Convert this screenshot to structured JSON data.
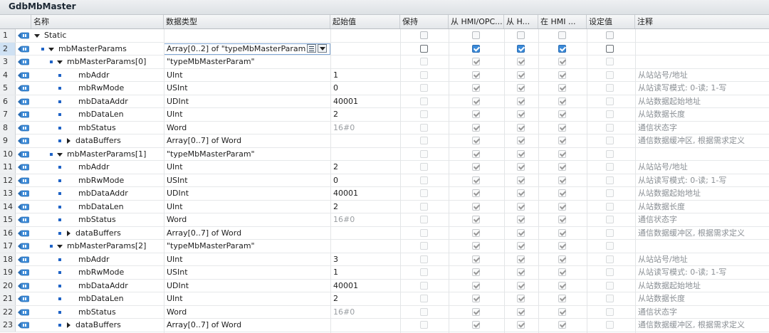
{
  "window": {
    "title": "GdbMbMaster"
  },
  "columns": {
    "name": "名称",
    "datatype": "数据类型",
    "start": "起始值",
    "retain": "保持",
    "hmi_opc": "从 HMI/OPC...",
    "hmi_h": "从 H...",
    "in_hmi": "在 HMI ...",
    "setpoint": "设定值",
    "comment": "注释"
  },
  "rows": [
    {
      "num": "1",
      "indent": 0,
      "bullet": false,
      "exp": "down",
      "name": "Static",
      "type": "",
      "start": "",
      "retain": false,
      "hmi": false,
      "hmih": false,
      "inhmi": false,
      "set": false,
      "comment": "",
      "dim": false
    },
    {
      "num": "2",
      "indent": 1,
      "bullet": true,
      "exp": "down",
      "name": "mbMasterParams",
      "type": "Array[0..2] of \"typeMbMasterParam\"",
      "start": "",
      "retain": false,
      "hmi": true,
      "hmih": true,
      "inhmi": true,
      "set": false,
      "comment": "",
      "dim": false,
      "sel": true
    },
    {
      "num": "3",
      "indent": 2,
      "bullet": true,
      "exp": "down",
      "name": "mbMasterParams[0]",
      "type": "\"typeMbMasterParam\"",
      "start": "",
      "retain": false,
      "hmi": true,
      "hmih": true,
      "inhmi": true,
      "set": false,
      "comment": "",
      "dim": true
    },
    {
      "num": "4",
      "indent": 3,
      "bullet": true,
      "exp": "",
      "name": "mbAddr",
      "type": "UInt",
      "start": "1",
      "retain": false,
      "hmi": true,
      "hmih": true,
      "inhmi": true,
      "set": false,
      "comment": "从站站号/地址",
      "dim": true
    },
    {
      "num": "5",
      "indent": 3,
      "bullet": true,
      "exp": "",
      "name": "mbRwMode",
      "type": "USInt",
      "start": "0",
      "retain": false,
      "hmi": true,
      "hmih": true,
      "inhmi": true,
      "set": false,
      "comment": "从站读写模式: 0-读; 1-写",
      "dim": true
    },
    {
      "num": "6",
      "indent": 3,
      "bullet": true,
      "exp": "",
      "name": "mbDataAddr",
      "type": "UDInt",
      "start": "40001",
      "retain": false,
      "hmi": true,
      "hmih": true,
      "inhmi": true,
      "set": false,
      "comment": "从站数据起始地址",
      "dim": true
    },
    {
      "num": "7",
      "indent": 3,
      "bullet": true,
      "exp": "",
      "name": "mbDataLen",
      "type": "UInt",
      "start": "2",
      "retain": false,
      "hmi": true,
      "hmih": true,
      "inhmi": true,
      "set": false,
      "comment": "从站数据长度",
      "dim": true
    },
    {
      "num": "8",
      "indent": 3,
      "bullet": true,
      "exp": "",
      "name": "mbStatus",
      "type": "Word",
      "start": "16#0",
      "startdim": true,
      "retain": false,
      "hmi": true,
      "hmih": true,
      "inhmi": true,
      "set": false,
      "comment": "通信状态字",
      "dim": true
    },
    {
      "num": "9",
      "indent": 3,
      "bullet": true,
      "exp": "right",
      "name": "dataBuffers",
      "type": "Array[0..7] of Word",
      "start": "",
      "retain": false,
      "hmi": true,
      "hmih": true,
      "inhmi": true,
      "set": false,
      "comment": "通信数据缓冲区, 根据需求定义",
      "dim": true
    },
    {
      "num": "10",
      "indent": 2,
      "bullet": true,
      "exp": "down",
      "name": "mbMasterParams[1]",
      "type": "\"typeMbMasterParam\"",
      "start": "",
      "retain": false,
      "hmi": true,
      "hmih": true,
      "inhmi": true,
      "set": false,
      "comment": "",
      "dim": true
    },
    {
      "num": "11",
      "indent": 3,
      "bullet": true,
      "exp": "",
      "name": "mbAddr",
      "type": "UInt",
      "start": "2",
      "retain": false,
      "hmi": true,
      "hmih": true,
      "inhmi": true,
      "set": false,
      "comment": "从站站号/地址",
      "dim": true
    },
    {
      "num": "12",
      "indent": 3,
      "bullet": true,
      "exp": "",
      "name": "mbRwMode",
      "type": "USInt",
      "start": "0",
      "retain": false,
      "hmi": true,
      "hmih": true,
      "inhmi": true,
      "set": false,
      "comment": "从站读写模式: 0-读; 1-写",
      "dim": true
    },
    {
      "num": "13",
      "indent": 3,
      "bullet": true,
      "exp": "",
      "name": "mbDataAddr",
      "type": "UDInt",
      "start": "40001",
      "retain": false,
      "hmi": true,
      "hmih": true,
      "inhmi": true,
      "set": false,
      "comment": "从站数据起始地址",
      "dim": true
    },
    {
      "num": "14",
      "indent": 3,
      "bullet": true,
      "exp": "",
      "name": "mbDataLen",
      "type": "UInt",
      "start": "2",
      "retain": false,
      "hmi": true,
      "hmih": true,
      "inhmi": true,
      "set": false,
      "comment": "从站数据长度",
      "dim": true
    },
    {
      "num": "15",
      "indent": 3,
      "bullet": true,
      "exp": "",
      "name": "mbStatus",
      "type": "Word",
      "start": "16#0",
      "startdim": true,
      "retain": false,
      "hmi": true,
      "hmih": true,
      "inhmi": true,
      "set": false,
      "comment": "通信状态字",
      "dim": true
    },
    {
      "num": "16",
      "indent": 3,
      "bullet": true,
      "exp": "right",
      "name": "dataBuffers",
      "type": "Array[0..7] of Word",
      "start": "",
      "retain": false,
      "hmi": true,
      "hmih": true,
      "inhmi": true,
      "set": false,
      "comment": "通信数据缓冲区, 根据需求定义",
      "dim": true
    },
    {
      "num": "17",
      "indent": 2,
      "bullet": true,
      "exp": "down",
      "name": "mbMasterParams[2]",
      "type": "\"typeMbMasterParam\"",
      "start": "",
      "retain": false,
      "hmi": true,
      "hmih": true,
      "inhmi": true,
      "set": false,
      "comment": "",
      "dim": true
    },
    {
      "num": "18",
      "indent": 3,
      "bullet": true,
      "exp": "",
      "name": "mbAddr",
      "type": "UInt",
      "start": "3",
      "retain": false,
      "hmi": true,
      "hmih": true,
      "inhmi": true,
      "set": false,
      "comment": "从站站号/地址",
      "dim": true
    },
    {
      "num": "19",
      "indent": 3,
      "bullet": true,
      "exp": "",
      "name": "mbRwMode",
      "type": "USInt",
      "start": "1",
      "retain": false,
      "hmi": true,
      "hmih": true,
      "inhmi": true,
      "set": false,
      "comment": "从站读写模式: 0-读; 1-写",
      "dim": true
    },
    {
      "num": "20",
      "indent": 3,
      "bullet": true,
      "exp": "",
      "name": "mbDataAddr",
      "type": "UDInt",
      "start": "40001",
      "retain": false,
      "hmi": true,
      "hmih": true,
      "inhmi": true,
      "set": false,
      "comment": "从站数据起始地址",
      "dim": true
    },
    {
      "num": "21",
      "indent": 3,
      "bullet": true,
      "exp": "",
      "name": "mbDataLen",
      "type": "UInt",
      "start": "2",
      "retain": false,
      "hmi": true,
      "hmih": true,
      "inhmi": true,
      "set": false,
      "comment": "从站数据长度",
      "dim": true
    },
    {
      "num": "22",
      "indent": 3,
      "bullet": true,
      "exp": "",
      "name": "mbStatus",
      "type": "Word",
      "start": "16#0",
      "startdim": true,
      "retain": false,
      "hmi": true,
      "hmih": true,
      "inhmi": true,
      "set": false,
      "comment": "通信状态字",
      "dim": true
    },
    {
      "num": "23",
      "indent": 3,
      "bullet": true,
      "exp": "right",
      "name": "dataBuffers",
      "type": "Array[0..7] of Word",
      "start": "",
      "retain": false,
      "hmi": true,
      "hmih": true,
      "inhmi": true,
      "set": false,
      "comment": "通信数据缓冲区, 根据需求定义",
      "dim": true
    }
  ],
  "icons": {
    "row_icon": "db-tag-icon",
    "expanded": "triangle-down-icon",
    "collapsed": "triangle-right-icon",
    "member": "member-bullet-icon"
  },
  "colors": {
    "accent": "#3b8ad8",
    "member_bullet": "#1f63c6",
    "comment_text": "#8a8f94"
  }
}
